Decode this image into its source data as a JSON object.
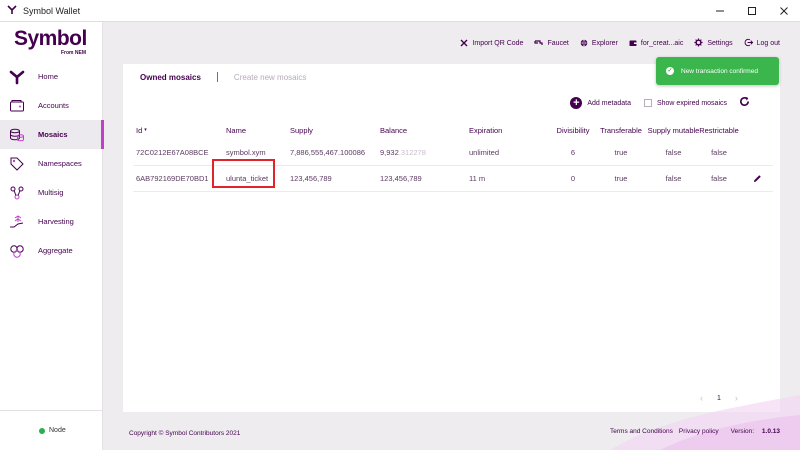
{
  "window": {
    "title": "Symbol Wallet"
  },
  "logo": {
    "text": "Symbol",
    "sub": "From NEM"
  },
  "sidebar": {
    "items": [
      {
        "label": "Home",
        "icon": "symbol-y-icon"
      },
      {
        "label": "Accounts",
        "icon": "accounts-icon"
      },
      {
        "label": "Mosaics",
        "icon": "coins-icon",
        "active": true
      },
      {
        "label": "Namespaces",
        "icon": "tag-icon"
      },
      {
        "label": "Multisig",
        "icon": "multisig-icon"
      },
      {
        "label": "Harvesting",
        "icon": "harvest-icon"
      },
      {
        "label": "Aggregate",
        "icon": "aggregate-icon"
      }
    ],
    "node_label": "Node",
    "node_status_color": "#2bb04c"
  },
  "topbar": {
    "actions": [
      {
        "label": "Import QR Code",
        "icon": "qr-icon"
      },
      {
        "label": "Faucet",
        "icon": "faucet-icon"
      },
      {
        "label": "Explorer",
        "icon": "globe-icon"
      },
      {
        "label": "for_creat...aic",
        "icon": "wallet-icon"
      },
      {
        "label": "Settings",
        "icon": "gear-icon"
      },
      {
        "label": "Log out",
        "icon": "logout-icon"
      }
    ]
  },
  "tabs": {
    "owned": "Owned mosaics",
    "create": "Create new mosaics"
  },
  "tools": {
    "add_metadata": "Add metadata",
    "show_expired": "Show expired mosaics"
  },
  "table": {
    "headers": {
      "id": "Id",
      "name": "Name",
      "supply": "Supply",
      "balance": "Balance",
      "expiration": "Expiration",
      "divisibility": "Divisibility",
      "transferable": "Transferable",
      "supply_mutable": "Supply mutable",
      "restrictable": "Restrictable"
    },
    "rows": [
      {
        "id": "72C0212E67A08BCE",
        "name": "symbol.xym",
        "supply": "7,886,555,467.100086",
        "balance_int": "9,932",
        "balance_frac": ".312278",
        "expiration": "unlimited",
        "divisibility": "6",
        "transferable": "true",
        "supply_mutable": "false",
        "restrictable": "false"
      },
      {
        "id": "6AB792169DE70BD1",
        "name": "ulunta_ticket",
        "supply": "123,456,789",
        "balance_int": "123,456,789",
        "balance_frac": "",
        "expiration": "11 m",
        "divisibility": "0",
        "transferable": "true",
        "supply_mutable": "false",
        "restrictable": "false"
      }
    ]
  },
  "pager": {
    "page": "1"
  },
  "footer": {
    "copyright": "Copyright © Symbol Contributors 2021",
    "terms": "Terms and Conditions",
    "privacy": "Privacy policy",
    "version_label": "Version:",
    "version": "1.0.13"
  },
  "toast": {
    "message": "New transaction confirmed",
    "color": "#3ab64c"
  },
  "colors": {
    "brand": "#44004e",
    "accent": "#c040c8",
    "highlight": "#e0242b"
  }
}
